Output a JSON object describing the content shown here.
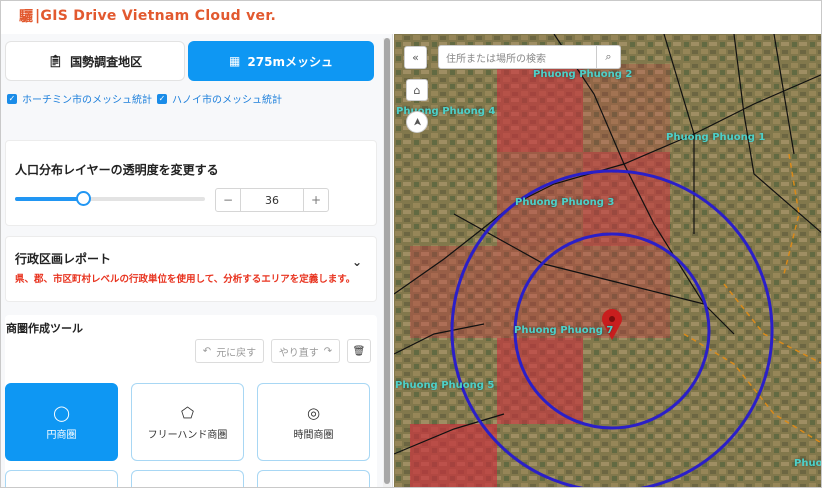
{
  "app": {
    "logo_glyph": "驪",
    "title": "|GIS Drive Vietnam Cloud ver."
  },
  "tabs": [
    {
      "label": "国勢調査地区",
      "icon": "clipboard-icon",
      "active": false
    },
    {
      "label": "275mメッシュ",
      "icon": "grid-icon",
      "active": true
    }
  ],
  "checkboxes": [
    {
      "label": "ホーチミン市のメッシュ統計",
      "checked": true
    },
    {
      "label": "ハノイ市のメッシュ統計",
      "checked": true
    }
  ],
  "opacity": {
    "heading": "人口分布レイヤーの透明度を変更する",
    "value": "36",
    "minus": "−",
    "plus": "+",
    "fraction": 0.36
  },
  "report": {
    "heading": "行政区画レポート",
    "description": "県、郡、市区町村レベルの行政単位を使用して、分析するエリアを定義します。",
    "chevron": "⌄"
  },
  "tools": {
    "heading": "商圏作成ツール",
    "undo": "元に戻す",
    "redo": "やり直す",
    "shapes": [
      {
        "label": "円商圏",
        "icon": "circle-icon",
        "selected": true
      },
      {
        "label": "フリーハンド商圏",
        "icon": "freehand-icon",
        "selected": false
      },
      {
        "label": "時間商圏",
        "icon": "time-rings-icon",
        "selected": false
      }
    ]
  },
  "map": {
    "search_placeholder": "住所または場所の検索",
    "collapse_glyph": "«",
    "labels": [
      "Phuong Phuong 2",
      "Phuong Phuong 4",
      "Phuong Phuong 1",
      "Phuong Phuong 3",
      "Phuong Phuong 7",
      "Phuong Phuong 5",
      "Phuo"
    ]
  },
  "colors": {
    "accent": "#0e97f3",
    "title": "#e2592f",
    "warning_text": "#e8331f",
    "mesh_red": "#d2283c",
    "circle": "#2b1fc8"
  }
}
